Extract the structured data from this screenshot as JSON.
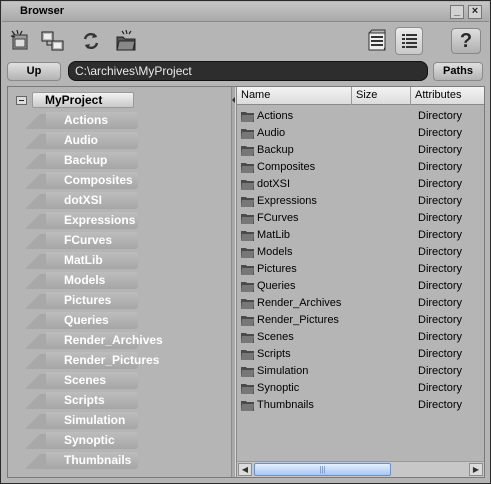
{
  "window": {
    "title": "Browser"
  },
  "toolbar": {
    "buttons": [
      "new-scene-icon",
      "network-icon",
      "refresh-icon",
      "folder-icon",
      "thumbnail-view-icon",
      "details-view-icon"
    ],
    "help_label": "?"
  },
  "pathbar": {
    "up_label": "Up",
    "path": "C:\\archives\\MyProject",
    "paths_label": "Paths"
  },
  "tree": {
    "root": "MyProject",
    "children": [
      "Actions",
      "Audio",
      "Backup",
      "Composites",
      "dotXSI",
      "Expressions",
      "FCurves",
      "MatLib",
      "Models",
      "Pictures",
      "Queries",
      "Render_Archives",
      "Render_Pictures",
      "Scenes",
      "Scripts",
      "Simulation",
      "Synoptic",
      "Thumbnails"
    ]
  },
  "filelist": {
    "columns": [
      "Name",
      "Size",
      "Attributes"
    ],
    "rows": [
      {
        "name": "Actions",
        "size": "",
        "attr": "Directory"
      },
      {
        "name": "Audio",
        "size": "",
        "attr": "Directory"
      },
      {
        "name": "Backup",
        "size": "",
        "attr": "Directory"
      },
      {
        "name": "Composites",
        "size": "",
        "attr": "Directory"
      },
      {
        "name": "dotXSI",
        "size": "",
        "attr": "Directory"
      },
      {
        "name": "Expressions",
        "size": "",
        "attr": "Directory"
      },
      {
        "name": "FCurves",
        "size": "",
        "attr": "Directory"
      },
      {
        "name": "MatLib",
        "size": "",
        "attr": "Directory"
      },
      {
        "name": "Models",
        "size": "",
        "attr": "Directory"
      },
      {
        "name": "Pictures",
        "size": "",
        "attr": "Directory"
      },
      {
        "name": "Queries",
        "size": "",
        "attr": "Directory"
      },
      {
        "name": "Render_Archives",
        "size": "",
        "attr": "Directory"
      },
      {
        "name": "Render_Pictures",
        "size": "",
        "attr": "Directory"
      },
      {
        "name": "Scenes",
        "size": "",
        "attr": "Directory"
      },
      {
        "name": "Scripts",
        "size": "",
        "attr": "Directory"
      },
      {
        "name": "Simulation",
        "size": "",
        "attr": "Directory"
      },
      {
        "name": "Synoptic",
        "size": "",
        "attr": "Directory"
      },
      {
        "name": "Thumbnails",
        "size": "",
        "attr": "Directory"
      }
    ]
  },
  "colors": {
    "window_bg": "#b5b5b5",
    "path_field_bg": "#2d2d2d",
    "scroll_thumb": "#a9c6f2",
    "folder": "#555555"
  }
}
